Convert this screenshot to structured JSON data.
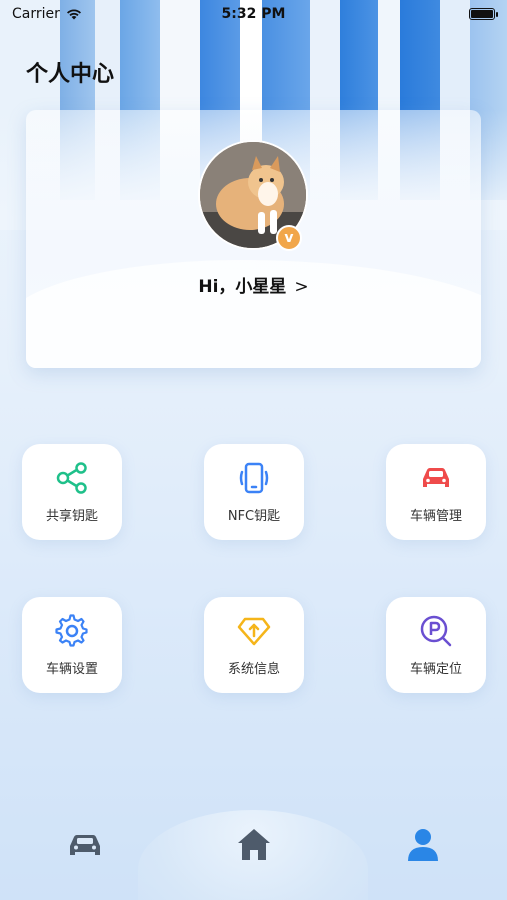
{
  "status_bar": {
    "carrier": "Carrier",
    "time": "5:32 PM"
  },
  "page": {
    "title": "个人中心"
  },
  "profile": {
    "greeting": "Hi，小星星",
    "chevron": ">",
    "badge": "v"
  },
  "tiles": [
    {
      "label": "共享钥匙",
      "icon": "share-icon",
      "color": "#1fc08a"
    },
    {
      "label": "NFC钥匙",
      "icon": "phone-nfc-icon",
      "color": "#3b82f6"
    },
    {
      "label": "车辆管理",
      "icon": "car-icon",
      "color": "#ef4b4b"
    },
    {
      "label": "车辆设置",
      "icon": "gear-icon",
      "color": "#3b82f6"
    },
    {
      "label": "系统信息",
      "icon": "diamond-arrow-icon",
      "color": "#f5b51a"
    },
    {
      "label": "车辆定位",
      "icon": "parking-locate-icon",
      "color": "#6a4fd1"
    }
  ],
  "tabbar": {
    "items": [
      "car-tab-icon",
      "home-tab-icon",
      "profile-tab-icon"
    ],
    "active_color": "#2a86e6",
    "inactive_color": "#4e5b6b"
  }
}
